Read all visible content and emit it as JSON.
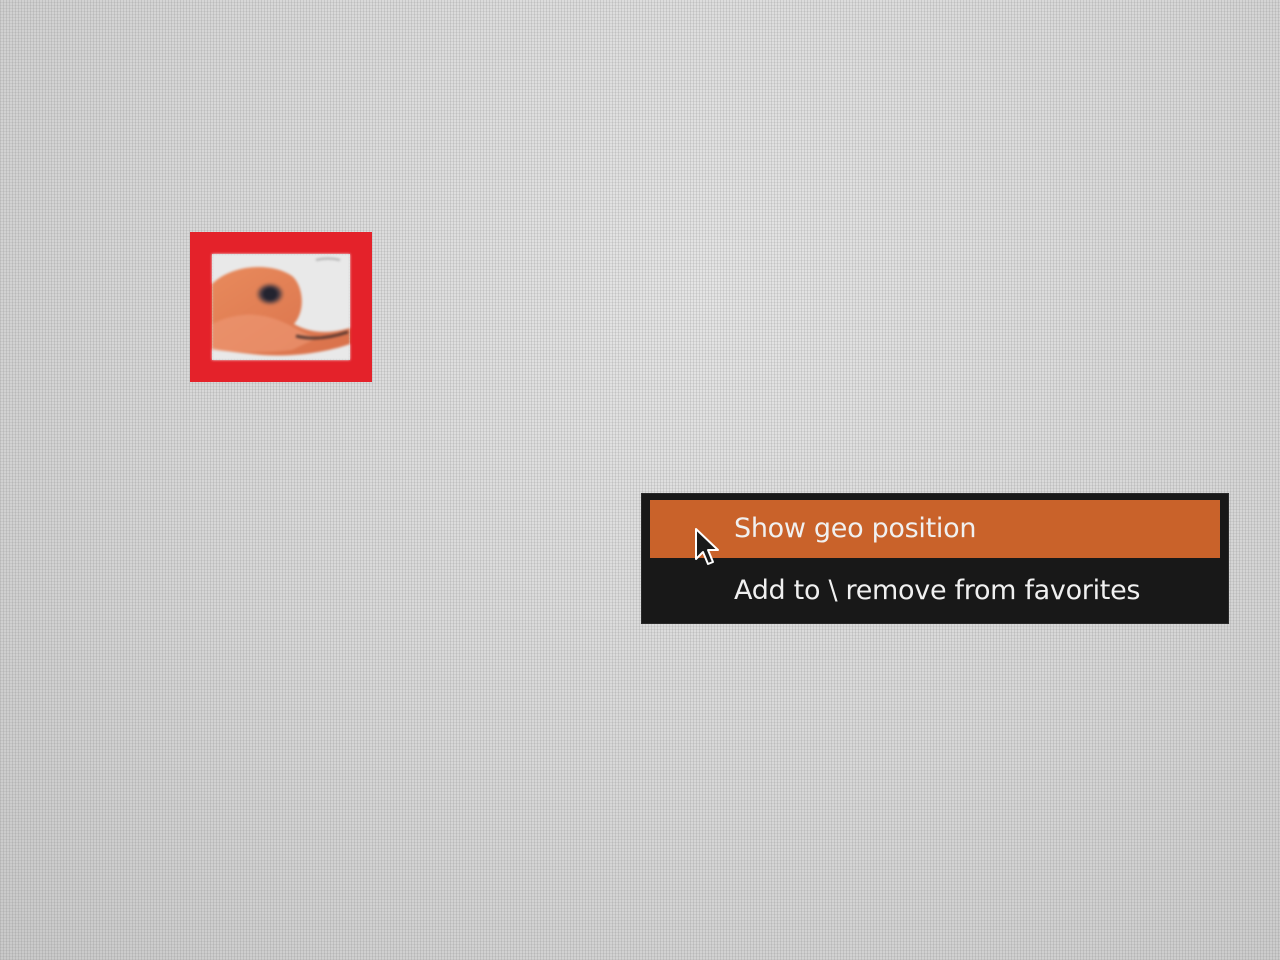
{
  "colors": {
    "background": "#d9d9d9",
    "selection_border": "#e4222a",
    "menu_background": "#181818",
    "menu_highlight": "#c9622a",
    "menu_text": "#f0f0f0"
  },
  "thumbnail": {
    "selected": true,
    "icon": "image-thumbnail"
  },
  "context_menu": {
    "items": [
      {
        "label": "Show geo position",
        "highlighted": true
      },
      {
        "label": "Add to \\ remove from favorites",
        "highlighted": false
      }
    ]
  },
  "cursor": {
    "icon": "arrow-cursor-icon"
  }
}
